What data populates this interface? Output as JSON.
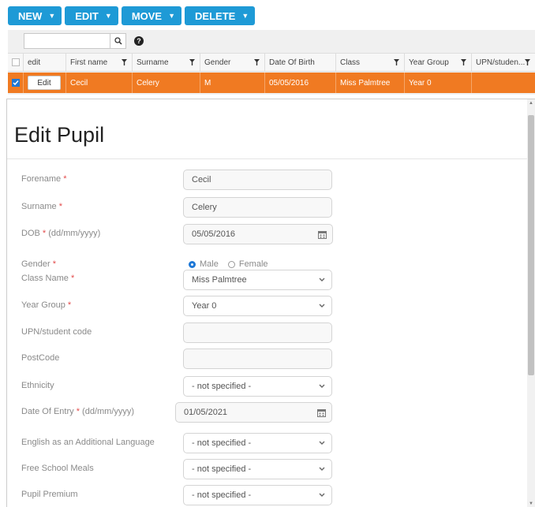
{
  "toolbar": {
    "buttons": [
      {
        "label": "NEW"
      },
      {
        "label": "EDIT"
      },
      {
        "label": "MOVE"
      },
      {
        "label": "DELETE"
      }
    ]
  },
  "grid": {
    "search": {
      "value": "",
      "placeholder": ""
    },
    "columns": [
      "edit",
      "First name",
      "Surname",
      "Gender",
      "Date Of Birth",
      "Class",
      "Year Group",
      "UPN/studen..."
    ],
    "row": {
      "edit_button": "Edit",
      "first_name": "Cecil",
      "surname": "Celery",
      "gender": "M",
      "dob": "05/05/2016",
      "class": "Miss Palmtree",
      "year_group": "Year 0",
      "upn": ""
    }
  },
  "modal": {
    "title": "Edit Pupil",
    "fields": {
      "forename": {
        "label": "Forename",
        "required": "*",
        "value": "Cecil"
      },
      "surname": {
        "label": "Surname",
        "required": "*",
        "value": "Celery"
      },
      "dob": {
        "label": "DOB",
        "required": "*",
        "hint": "(dd/mm/yyyy)",
        "value": "05/05/2016"
      },
      "gender": {
        "label": "Gender",
        "required": "*",
        "options": [
          "Male",
          "Female"
        ],
        "selected": "Male"
      },
      "class_name": {
        "label": "Class Name",
        "required": "*",
        "value": "Miss Palmtree"
      },
      "year_group": {
        "label": "Year Group",
        "required": "*",
        "value": "Year 0"
      },
      "upn": {
        "label": "UPN/student code",
        "value": ""
      },
      "postcode": {
        "label": "PostCode",
        "value": ""
      },
      "ethnicity": {
        "label": "Ethnicity",
        "value": "- not specified -"
      },
      "date_of_entry": {
        "label": "Date Of Entry",
        "required": "*",
        "hint": "(dd/mm/yyyy)",
        "value": "01/05/2021"
      },
      "eal": {
        "label": "English as an Additional Language",
        "value": "- not specified -"
      },
      "fsm": {
        "label": "Free School Meals",
        "value": "- not specified -"
      },
      "pupil_premium": {
        "label": "Pupil Premium",
        "value": "- not specified -"
      }
    }
  },
  "colors": {
    "toolbar_blue": "#1e9ad6",
    "selected_row": "#f07a22",
    "required_mark": "#e34b4b",
    "radio_selected": "#1e78d6"
  }
}
